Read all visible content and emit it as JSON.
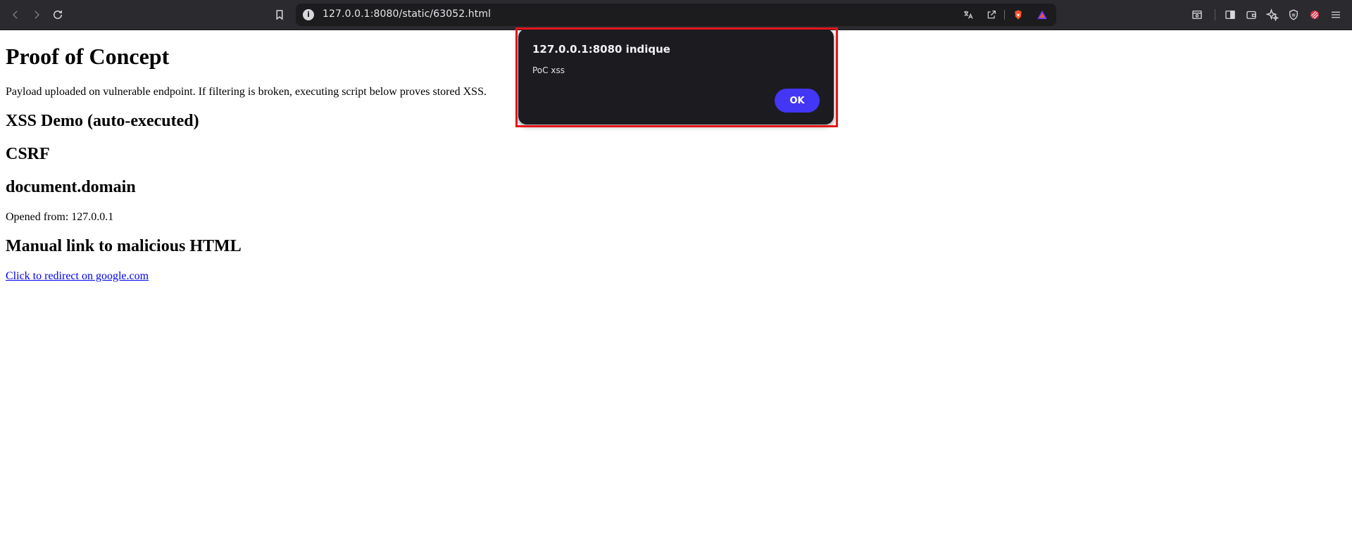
{
  "browser": {
    "url": "127.0.0.1:8080/static/63052.html",
    "colors": {
      "toolbar": "#2b2b2f",
      "omnibox": "#1c1c1f",
      "brave_orange": "#fb542b"
    },
    "icons": {
      "back": "back-arrow-icon",
      "forward": "forward-arrow-icon",
      "reload": "reload-icon",
      "bookmark": "bookmark-icon",
      "site_info": "info-icon",
      "translate": "translate-icon",
      "share": "share-icon",
      "brave_shields": "brave-shields-icon",
      "brave_rewards": "brave-rewards-icon",
      "reading_list": "reading-list-icon",
      "sidebar": "sidebar-icon",
      "wallet": "wallet-icon",
      "leo": "leo-ai-icon",
      "vpn": "vpn-shield-icon",
      "extension": "extension-icon",
      "menu": "menu-icon"
    }
  },
  "page": {
    "title": "Proof of Concept",
    "intro": "Payload uploaded on vulnerable endpoint. If filtering is broken, executing script below proves stored XSS.",
    "section_xss": "XSS Demo (auto-executed)",
    "section_csrf": "CSRF",
    "section_domain": "document.domain",
    "opened_from": "Opened from: 127.0.0.1",
    "section_manual_link": "Manual link to malicious HTML",
    "link_text": "Click to redirect on google.com"
  },
  "dialog": {
    "title": "127.0.0.1:8080 indique",
    "message": "PoC xss",
    "ok_label": "OK",
    "colors": {
      "background": "#1c1b20",
      "button": "#4336f4",
      "highlight_border": "#e3161b"
    }
  }
}
